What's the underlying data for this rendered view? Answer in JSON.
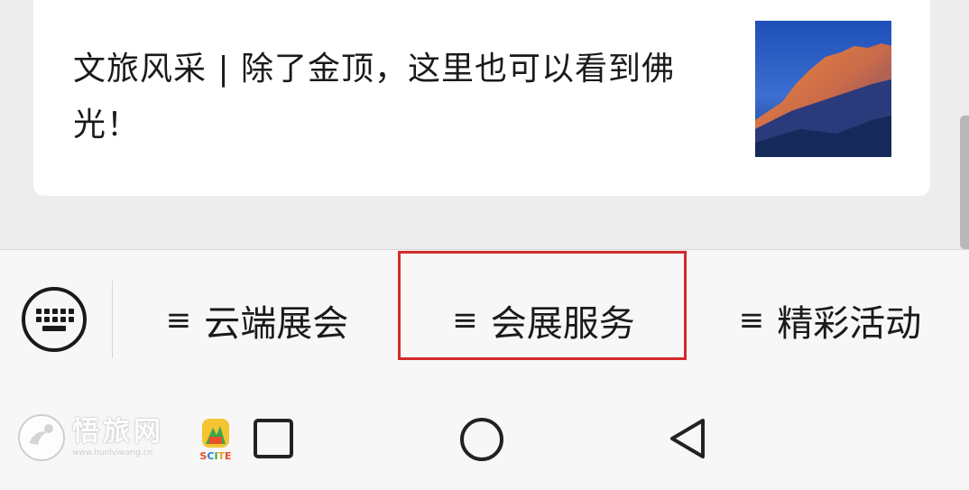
{
  "article": {
    "title": "文旅风采 | 除了金顶，这里也可以看到佛光！",
    "thumbnail_icon": "mountain-photo"
  },
  "menu": {
    "keyboard_icon": "keyboard-icon",
    "items": [
      {
        "label": "云端展会",
        "icon": "menu-lines-icon"
      },
      {
        "label": "会展服务",
        "icon": "menu-lines-icon",
        "highlighted": true
      },
      {
        "label": "精彩活动",
        "icon": "menu-lines-icon"
      }
    ],
    "hamburger_glyph": "≡",
    "highlight_color": "#d32a2a"
  },
  "navbar": {
    "recent_icon": "square-icon",
    "home_icon": "circle-icon",
    "back_icon": "triangle-back-icon"
  },
  "watermark": {
    "title": "悟旅网",
    "url": "www.hunlviwang.cn",
    "badge_text": "SCITE"
  }
}
